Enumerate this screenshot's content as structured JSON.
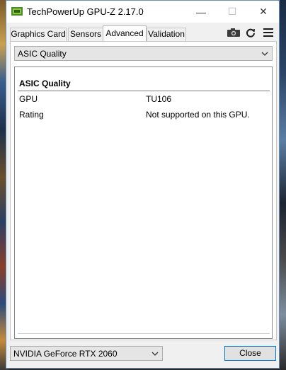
{
  "window": {
    "title": "TechPowerUp GPU-Z 2.17.0",
    "app_icon": "gpu-z-icon",
    "controls": {
      "minimize": "—",
      "maximize": "☐",
      "close": "✕"
    }
  },
  "tabs": [
    {
      "label": "Graphics Card",
      "active": false
    },
    {
      "label": "Sensors",
      "active": false
    },
    {
      "label": "Advanced",
      "active": true
    },
    {
      "label": "Validation",
      "active": false
    }
  ],
  "toolbar": {
    "icons": [
      "camera-icon",
      "refresh-icon",
      "hamburger-menu-icon"
    ]
  },
  "advanced": {
    "selector_value": "ASIC Quality",
    "section_title": "ASIC Quality",
    "rows": [
      {
        "key": "GPU",
        "value": "TU106"
      },
      {
        "key": "Rating",
        "value": "Not supported on this GPU."
      }
    ]
  },
  "footer": {
    "gpu_select_value": "NVIDIA GeForce RTX 2060",
    "close_label": "Close"
  },
  "colors": {
    "focus_border": "#0078d7",
    "window_bg": "#f0f0f0",
    "list_bg": "#ffffff"
  }
}
